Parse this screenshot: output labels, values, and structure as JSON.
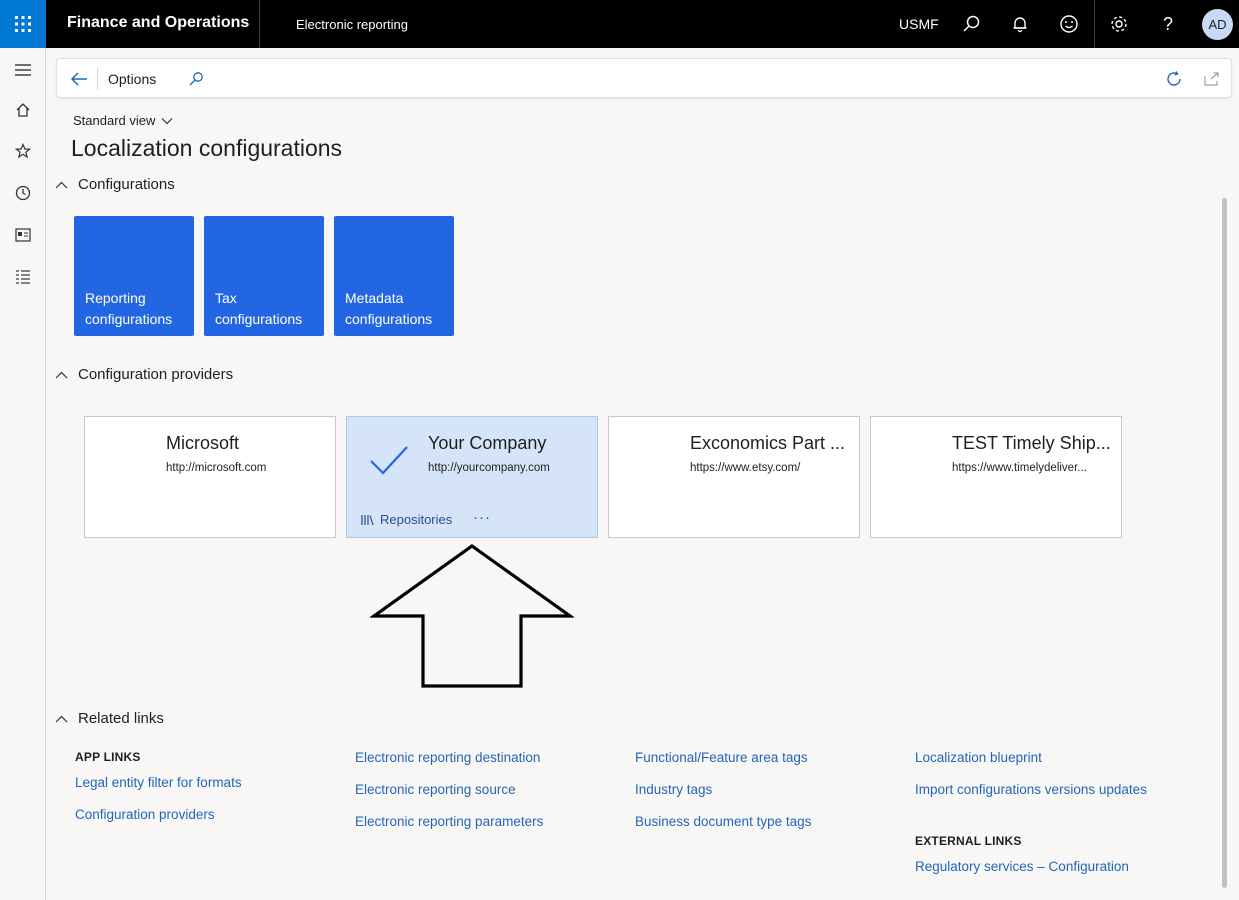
{
  "topbar": {
    "app_title": "Finance and Operations",
    "module_title": "Electronic reporting",
    "company": "USMF",
    "avatar_initials": "AD",
    "accent_color": "#0078d4"
  },
  "action_pane": {
    "options_label": "Options"
  },
  "view": {
    "selector_label": "Standard view",
    "page_title": "Localization configurations"
  },
  "sections": {
    "configurations": "Configurations",
    "providers": "Configuration providers",
    "related_links": "Related links"
  },
  "tiles": [
    {
      "label": "Reporting configurations"
    },
    {
      "label": "Tax configurations"
    },
    {
      "label": "Metadata configurations"
    }
  ],
  "providers": [
    {
      "name": "Microsoft",
      "url": "http://microsoft.com",
      "active": false
    },
    {
      "name": "Your Company",
      "url": "http://yourcompany.com",
      "active": true,
      "action_label": "Repositories",
      "more_label": "···"
    },
    {
      "name": "Exconomics Part ...",
      "url": "https://www.etsy.com/",
      "active": false
    },
    {
      "name": "TEST Timely Ship...",
      "url": "https://www.timelydeliver...",
      "active": false
    }
  ],
  "related_links": {
    "app_links_heading": "APP LINKS",
    "external_links_heading": "EXTERNAL LINKS",
    "col1": [
      "Legal entity filter for formats",
      "Configuration providers"
    ],
    "col2": [
      "Electronic reporting destination",
      "Electronic reporting source",
      "Electronic reporting parameters"
    ],
    "col3": [
      "Functional/Feature area tags",
      "Industry tags",
      "Business document type tags"
    ],
    "col4": [
      "Localization blueprint",
      "Import configurations versions updates"
    ],
    "external": [
      "Regulatory services – Configuration"
    ]
  },
  "colors": {
    "tile": "#2266e3",
    "active_card": "#d6e4fa",
    "link": "#2266b8"
  }
}
